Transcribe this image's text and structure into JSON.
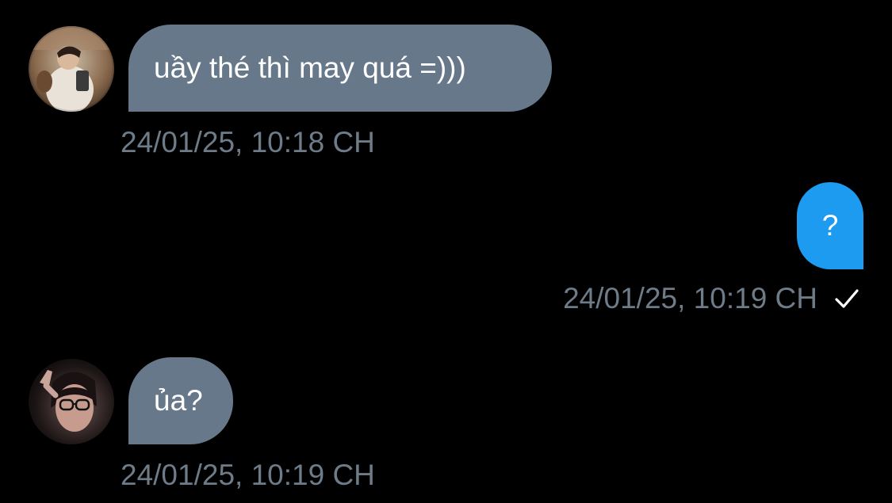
{
  "messages": [
    {
      "direction": "incoming",
      "text": "uầy thé thì may quá =)))",
      "timestamp": "24/01/25, 10:18 CH",
      "avatar": "avatar-photo-young-man-holding-phone"
    },
    {
      "direction": "outgoing",
      "text": "?",
      "timestamp": "24/01/25, 10:19 CH",
      "status_icon": "check-icon"
    },
    {
      "direction": "incoming",
      "text": "ủa?",
      "timestamp": "24/01/25, 10:19 CH",
      "avatar": "avatar-photo-woman-glasses-waving"
    }
  ],
  "colors": {
    "background": "#000000",
    "incoming_bubble": "#66788a",
    "outgoing_bubble": "#1d9bf0",
    "timestamp_text": "#6e7b88",
    "message_text": "#ffffff"
  }
}
